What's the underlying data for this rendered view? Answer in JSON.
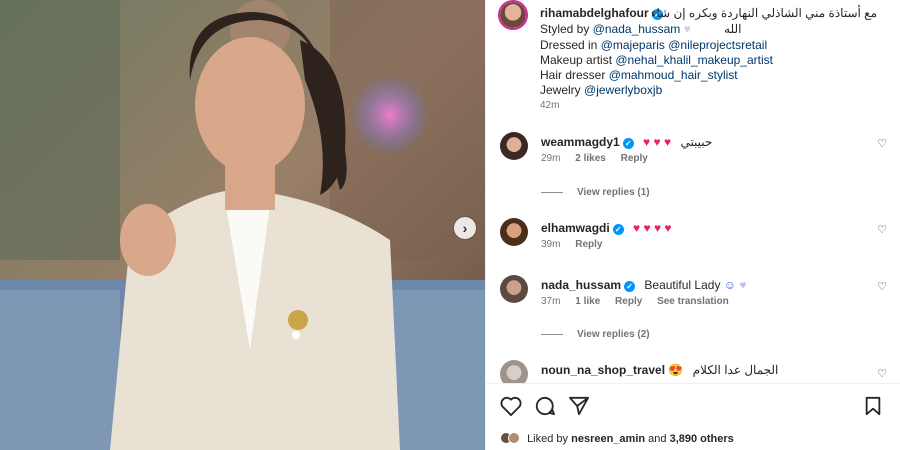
{
  "post": {
    "username": "rihamabdelghafour",
    "caption_rtl": "مع أستاذة مني الشاذلي النهاردة وبكره إن شاء",
    "caption_rtl2": "الله",
    "styled_by_label": "Styled by",
    "styled_by": "@nada_hussam",
    "dressed_label": "Dressed in",
    "dressed_1": "@majeparis",
    "dressed_2": "@nileprojectsretail",
    "makeup_label": "Makeup artist",
    "makeup": "@nehal_khalil_makeup_artist",
    "hair_label": "Hair dresser",
    "hair": "@mahmoud_hair_stylist",
    "jewelry_label": "Jewelry",
    "jewelry": "@jewerlyboxjb",
    "time": "42m"
  },
  "comments": [
    {
      "user": "weammagdy1",
      "text": "حبيبتي",
      "hearts": "♥ ♥ ♥",
      "time": "29m",
      "likes": "2 likes",
      "reply": "Reply",
      "view_replies": "View replies (1)"
    },
    {
      "user": "elhamwagdi",
      "hearts": "♥ ♥ ♥ ♥",
      "time": "39m",
      "reply": "Reply"
    },
    {
      "user": "nada_hussam",
      "text": "Beautiful Lady",
      "time": "37m",
      "likes": "1 like",
      "reply": "Reply",
      "translation": "See translation",
      "view_replies": "View replies (2)"
    },
    {
      "user": "noun_na_shop_travel",
      "text": "الجمال عدا الكلام"
    }
  ],
  "likes": {
    "prefix": "Liked by",
    "user": "nesreen_amin",
    "and": "and",
    "others": "3,890 others"
  },
  "icons": {
    "heart": "heart-icon",
    "comment": "comment-icon",
    "share": "share-icon",
    "save": "bookmark-icon",
    "next": "chevron-right-icon"
  },
  "colors": {
    "mention": "#00376b",
    "verified": "#0095f6",
    "meta": "#737373",
    "emoji_heart": "#ed1f5b"
  }
}
